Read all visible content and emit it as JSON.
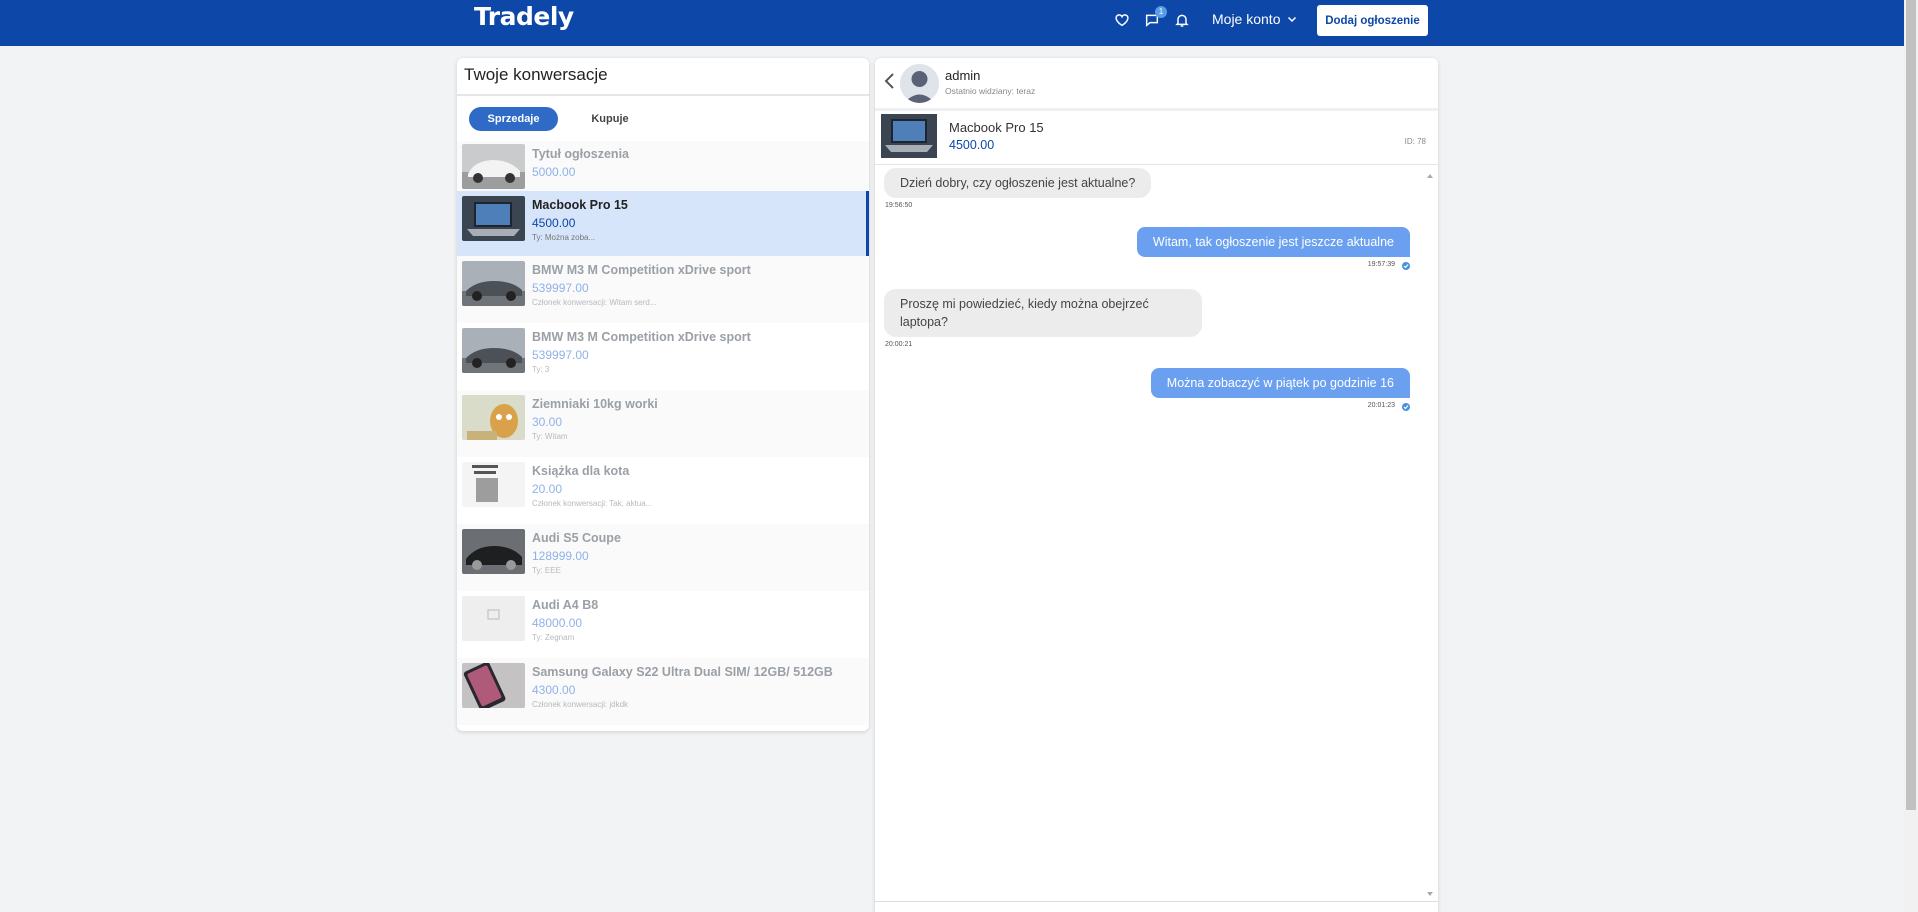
{
  "navbar": {
    "brand": "Tradely",
    "messages_badge": "1",
    "account_label": "Moje konto",
    "add_button": "Dodaj ogłoszenie"
  },
  "left": {
    "title": "Twoje konwersacje",
    "tabs": [
      "Sprzedaje",
      "Kupuje"
    ],
    "conversations": [
      {
        "title": "Tytuł ogłoszenia",
        "price": "5000.00",
        "sub": ""
      },
      {
        "title": "Macbook Pro 15",
        "price": "4500.00",
        "sub": "Ty: Można zoba..."
      },
      {
        "title": "BMW M3 M Competition xDrive sport",
        "price": "539997.00",
        "sub": "Członek konwersacji: Witam serd..."
      },
      {
        "title": "BMW M3 M Competition xDrive sport",
        "price": "539997.00",
        "sub": "Ty: 3"
      },
      {
        "title": "Ziemniaki 10kg worki",
        "price": "30.00",
        "sub": "Ty: Witam"
      },
      {
        "title": "Książka dla kota",
        "price": "20.00",
        "sub": "Członek konwersacji: Tak, aktua..."
      },
      {
        "title": "Audi S5 Coupe",
        "price": "128999.00",
        "sub": "Ty: EEE"
      },
      {
        "title": "Audi A4 B8",
        "price": "48000.00",
        "sub": "Ty: Zegnam"
      },
      {
        "title": "Samsung Galaxy S22 Ultra Dual SIM/ 12GB/ 512GB",
        "price": "4300.00",
        "sub": "Członek konwersacji: jdkdk"
      }
    ]
  },
  "chat": {
    "user": "admin",
    "last_seen": "Ostatnio widziany: teraz",
    "product": {
      "title": "Macbook Pro 15",
      "price": "4500.00",
      "id": "ID: 78"
    },
    "messages": [
      {
        "dir": "in",
        "text": "Dzień dobry, czy ogłoszenie jest aktualne?",
        "time": "19:56:50"
      },
      {
        "dir": "out",
        "text": "Witam, tak ogłoszenie jest jeszcze aktualne",
        "time": "19:57:39"
      },
      {
        "dir": "in",
        "text": "Proszę mi powiedzieć, kiedy można obejrzeć laptopa?",
        "time": "20:00:21"
      },
      {
        "dir": "out",
        "text": "Można zobaczyć w piątek po godzinie 16",
        "time": "20:01:23"
      }
    ]
  },
  "colors": {
    "brand": "#0d47a8",
    "accent": "#2f6ac6",
    "outgoing_bubble": "#6aa0ef"
  }
}
